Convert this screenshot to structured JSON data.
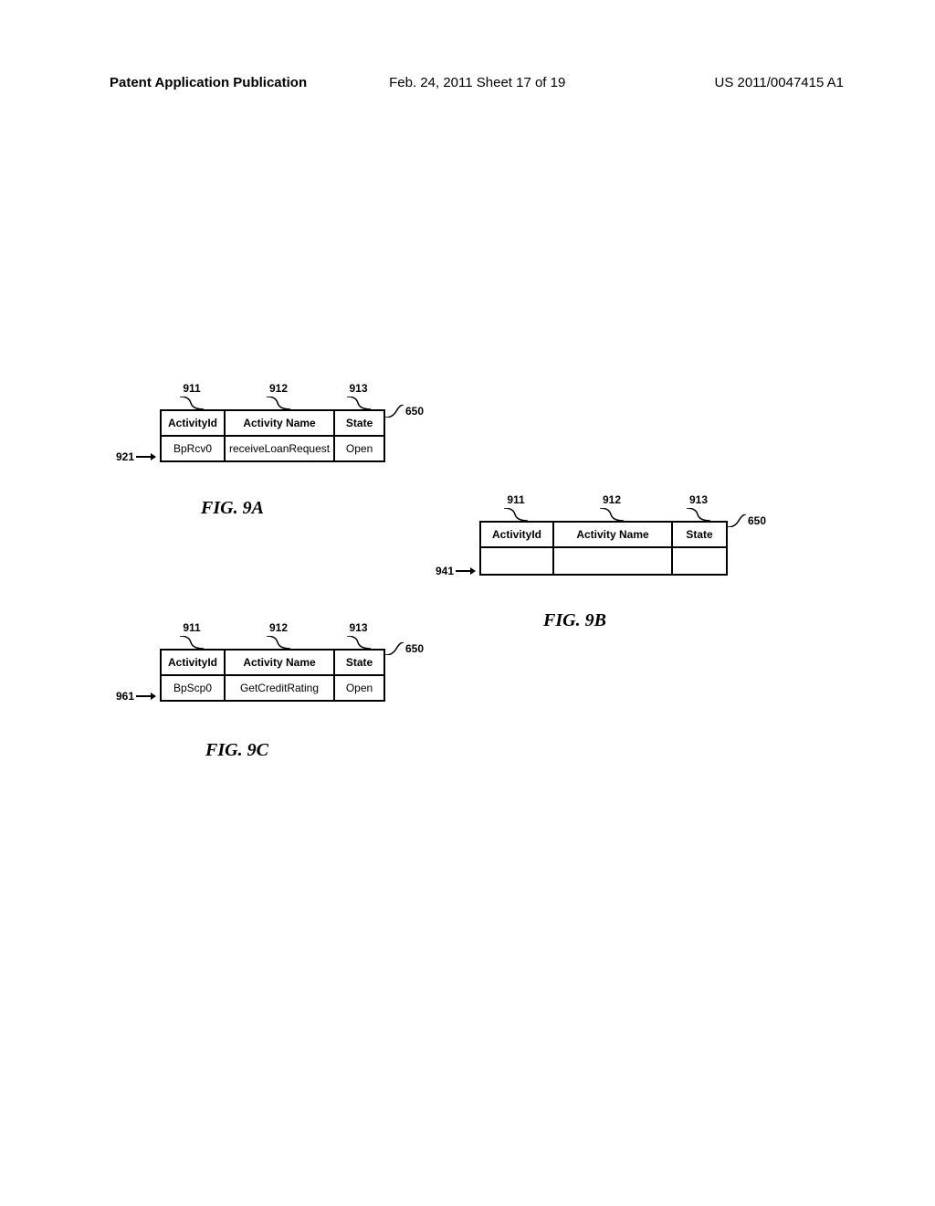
{
  "header": {
    "left": "Patent Application Publication",
    "center": "Feb. 24, 2011  Sheet 17 of 19",
    "right": "US 2011/0047415 A1"
  },
  "labels": {
    "col1": "911",
    "col2": "912",
    "col3": "913",
    "tableRef": "650"
  },
  "headers": {
    "activityId": "ActivityId",
    "activityName": "Activity Name",
    "state": "State"
  },
  "fig9a": {
    "rowLabel": "921",
    "row": {
      "activityId": "BpRcv0",
      "activityName": "receiveLoanRequest",
      "state": "Open"
    },
    "caption": "FIG. 9A"
  },
  "fig9b": {
    "rowLabel": "941",
    "row": {
      "activityId": "",
      "activityName": "",
      "state": ""
    },
    "caption": "FIG. 9B"
  },
  "fig9c": {
    "rowLabel": "961",
    "row": {
      "activityId": "BpScp0",
      "activityName": "GetCreditRating",
      "state": "Open"
    },
    "caption": "FIG. 9C"
  }
}
